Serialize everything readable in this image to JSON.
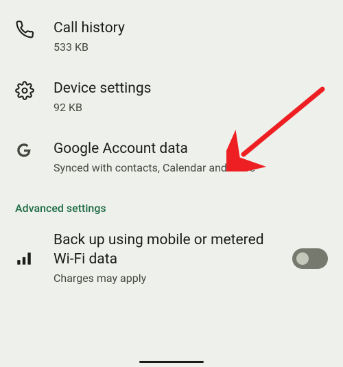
{
  "items": [
    {
      "name": "call-history",
      "icon": "phone",
      "title": "Call history",
      "subtitle": "533 KB"
    },
    {
      "name": "device-settings",
      "icon": "gear",
      "title": "Device settings",
      "subtitle": "92 KB"
    },
    {
      "name": "google-account-data",
      "icon": "g-logo",
      "title": "Google Account data",
      "subtitle": "Synced with contacts, Calendar and more"
    }
  ],
  "section_advanced": "Advanced settings",
  "backup": {
    "title": "Back up using mobile or metered Wi-Fi data",
    "subtitle": "Charges may apply",
    "enabled": false
  },
  "colors": {
    "bg": "#eef0ec",
    "text": "#1a1c18",
    "subtext": "#45483f",
    "accent": "#1f6d45",
    "arrow": "#ee1f22"
  }
}
